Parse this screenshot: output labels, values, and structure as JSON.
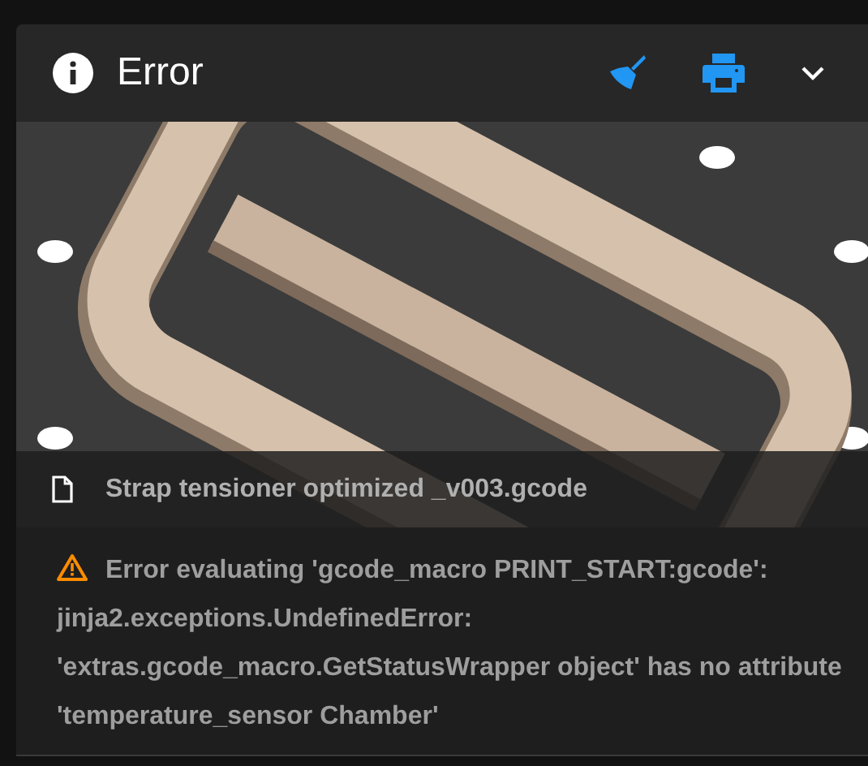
{
  "panel": {
    "title": "Error"
  },
  "file": {
    "name": "Strap tensioner optimized _v003.gcode"
  },
  "message": {
    "text": "Error evaluating 'gcode_macro PRINT_START:gcode': jinja2.exceptions.UndefinedError: 'extras.gcode_macro.GetStatusWrapper object' has no attribute 'temperature_sensor Chamber'"
  }
}
